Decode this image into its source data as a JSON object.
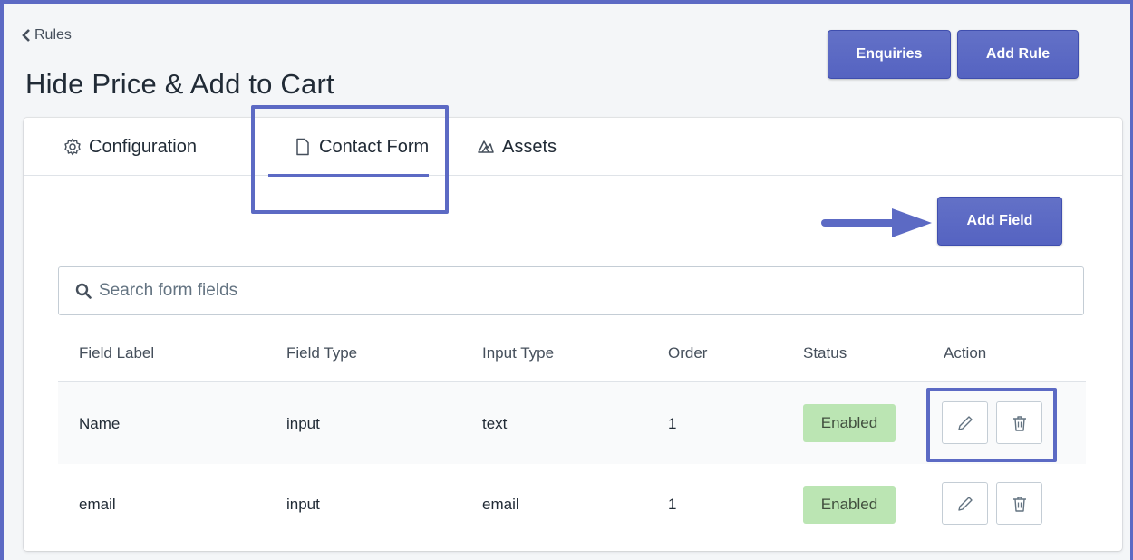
{
  "header": {
    "breadcrumb": "Rules",
    "title": "Hide Price & Add to Cart",
    "enquiries_label": "Enquiries",
    "add_rule_label": "Add Rule"
  },
  "tabs": [
    {
      "label": "Configuration",
      "icon": "gear-icon"
    },
    {
      "label": "Contact Form",
      "icon": "document-icon",
      "active": true
    },
    {
      "label": "Assets",
      "icon": "assets-icon"
    }
  ],
  "add_field_label": "Add Field",
  "search": {
    "placeholder": "Search form fields",
    "value": ""
  },
  "table": {
    "headers": [
      "Field Label",
      "Field Type",
      "Input Type",
      "Order",
      "Status",
      "Action"
    ],
    "rows": [
      {
        "label": "Name",
        "field_type": "input",
        "input_type": "text",
        "order": "1",
        "status": "Enabled"
      },
      {
        "label": "email",
        "field_type": "input",
        "input_type": "email",
        "order": "1",
        "status": "Enabled"
      }
    ]
  },
  "colors": {
    "accent": "#5c6ac4",
    "enabled_badge": "#bbe5b3"
  }
}
